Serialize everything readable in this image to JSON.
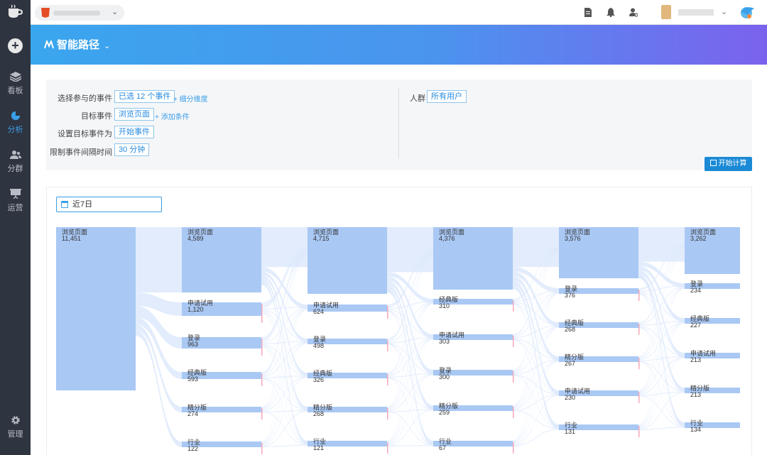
{
  "nav": {
    "items": [
      {
        "key": "dashboard",
        "label": "看板",
        "icon": "layers-icon"
      },
      {
        "key": "analysis",
        "label": "分析",
        "icon": "pie-chart-icon",
        "active": true
      },
      {
        "key": "segments",
        "label": "分群",
        "icon": "users-icon"
      },
      {
        "key": "operations",
        "label": "运营",
        "icon": "presentation-icon"
      }
    ],
    "manage_label": "管理"
  },
  "banner": {
    "title": "智能路径"
  },
  "filters": {
    "events_label": "选择参与的事件",
    "events_value": "已选 12 个事件",
    "events_link": "+ 细分维度",
    "target_label": "目标事件",
    "target_value": "浏览页面",
    "target_link": "+ 添加条件",
    "set_target_label": "设置目标事件为",
    "set_target_value": "开始事件",
    "interval_label": "限制事件间隔时间",
    "interval_value": "30  分钟",
    "crowd_label": "人群",
    "crowd_value": "所有用户",
    "calc_button": "开始计算"
  },
  "date_range": "近7日",
  "colors": {
    "accent": "#3a9ee8",
    "node": "#a9c8f4",
    "link": "#dde9fb",
    "nav_bg": "#2e3440"
  },
  "chart_data": {
    "type": "sankey",
    "columns": [
      [
        {
          "name": "浏览页面",
          "value": "11,451"
        }
      ],
      [
        {
          "name": "浏览页面",
          "value": "4,589"
        },
        {
          "name": "申请试用",
          "value": "1,120"
        },
        {
          "name": "登录",
          "value": "963"
        },
        {
          "name": "经典版",
          "value": "593"
        },
        {
          "name": "精分版",
          "value": "274"
        },
        {
          "name": "行业",
          "value": "122"
        }
      ],
      [
        {
          "name": "浏览页面",
          "value": "4,715"
        },
        {
          "name": "申请试用",
          "value": "624"
        },
        {
          "name": "登录",
          "value": "498"
        },
        {
          "name": "经典版",
          "value": "326"
        },
        {
          "name": "精分版",
          "value": "268"
        },
        {
          "name": "行业",
          "value": "121"
        }
      ],
      [
        {
          "name": "浏览页面",
          "value": "4,376"
        },
        {
          "name": "经典版",
          "value": "310"
        },
        {
          "name": "申请试用",
          "value": "303"
        },
        {
          "name": "登录",
          "value": "300"
        },
        {
          "name": "精分版",
          "value": "259"
        },
        {
          "name": "行业",
          "value": "67"
        }
      ],
      [
        {
          "name": "浏览页面",
          "value": "3,576"
        },
        {
          "name": "登录",
          "value": "376"
        },
        {
          "name": "经典版",
          "value": "268"
        },
        {
          "name": "精分版",
          "value": "267"
        },
        {
          "name": "申请试用",
          "value": "230"
        },
        {
          "name": "行业",
          "value": "131"
        }
      ],
      [
        {
          "name": "浏览页面",
          "value": "3,262"
        },
        {
          "name": "登录",
          "value": "234"
        },
        {
          "name": "经典版",
          "value": "227"
        },
        {
          "name": "申请试用",
          "value": "213"
        },
        {
          "name": "精分版",
          "value": "213"
        },
        {
          "name": "行业",
          "value": "134"
        }
      ]
    ]
  }
}
